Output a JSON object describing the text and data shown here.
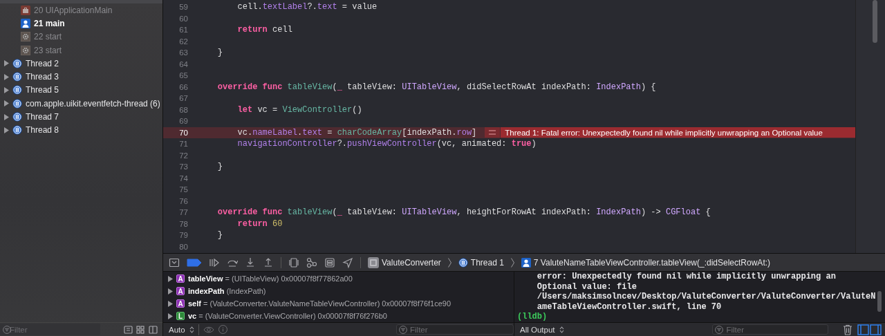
{
  "sidebar": {
    "frames": [
      {
        "label": "20 UIApplicationMain",
        "kind": "library"
      },
      {
        "label": "21 main",
        "kind": "user"
      },
      {
        "label": "22 start",
        "kind": "system"
      },
      {
        "label": "23 start",
        "kind": "system"
      }
    ],
    "threads": [
      {
        "label": "Thread 2",
        "expanded": false
      },
      {
        "label": "Thread 3",
        "expanded": false
      },
      {
        "label": "Thread 5",
        "expanded": false
      },
      {
        "label": "com.apple.uikit.eventfetch-thread (6)",
        "expanded": false
      },
      {
        "label": "Thread 7",
        "expanded": false
      },
      {
        "label": "Thread 8",
        "expanded": false
      }
    ],
    "filter": {
      "placeholder": "Filter"
    }
  },
  "editor": {
    "lines": [
      {
        "number": "59",
        "tokens": [
          {
            "text": "        cell.",
            "kind": "plain"
          },
          {
            "text": "textLabel",
            "kind": "prop"
          },
          {
            "text": "?.",
            "kind": "plain"
          },
          {
            "text": "text",
            "kind": "prop"
          },
          {
            "text": " = value",
            "kind": "plain"
          }
        ]
      },
      {
        "number": "60"
      },
      {
        "number": "61",
        "tokens": [
          {
            "text": "        return",
            "kind": "kw"
          },
          {
            "text": " cell",
            "kind": "plain"
          }
        ]
      },
      {
        "number": "62"
      },
      {
        "number": "63",
        "tokens": [
          {
            "text": "    }",
            "kind": "plain"
          }
        ]
      },
      {
        "number": "64"
      },
      {
        "number": "65"
      },
      {
        "number": "66",
        "tokens": [
          {
            "text": "    override func",
            "kind": "kw"
          },
          {
            "text": " tableView",
            "kind": "fn"
          },
          {
            "text": "(",
            "kind": "plain"
          },
          {
            "text": "_",
            "kind": "kw"
          },
          {
            "text": " tableView: ",
            "kind": "plain"
          },
          {
            "text": "UITableView",
            "kind": "type"
          },
          {
            "text": ", didSelectRowAt indexPath: ",
            "kind": "plain"
          },
          {
            "text": "IndexPath",
            "kind": "type"
          },
          {
            "text": ") {",
            "kind": "plain"
          }
        ]
      },
      {
        "number": "67"
      },
      {
        "number": "68",
        "tokens": [
          {
            "text": "        let",
            "kind": "kw"
          },
          {
            "text": " vc = ",
            "kind": "plain"
          },
          {
            "text": "ViewController",
            "kind": "fn"
          },
          {
            "text": "()",
            "kind": "plain"
          }
        ]
      },
      {
        "number": "69"
      },
      {
        "number": "70",
        "tokens": [
          {
            "text": "        vc.",
            "kind": "plain"
          },
          {
            "text": "nameLabel",
            "kind": "prop"
          },
          {
            "text": ".",
            "kind": "plain"
          },
          {
            "text": "text",
            "kind": "prop"
          },
          {
            "text": " = ",
            "kind": "plain"
          },
          {
            "text": "charCodeArray",
            "kind": "fn"
          },
          {
            "text": "[indexPath.",
            "kind": "plain"
          },
          {
            "text": "row",
            "kind": "prop"
          },
          {
            "text": "]",
            "kind": "plain"
          }
        ],
        "error": "Thread 1: Fatal error: Unexpectedly found nil while implicitly unwrapping an Optional value"
      },
      {
        "number": "71",
        "tokens": [
          {
            "text": "        navigationController",
            "kind": "prop"
          },
          {
            "text": "?.",
            "kind": "plain"
          },
          {
            "text": "pushViewController",
            "kind": "prop"
          },
          {
            "text": "(vc, animated: ",
            "kind": "plain"
          },
          {
            "text": "true",
            "kind": "kw"
          },
          {
            "text": ")",
            "kind": "plain"
          }
        ]
      },
      {
        "number": "72"
      },
      {
        "number": "73",
        "tokens": [
          {
            "text": "    }",
            "kind": "plain"
          }
        ]
      },
      {
        "number": "74"
      },
      {
        "number": "75"
      },
      {
        "number": "76"
      },
      {
        "number": "77",
        "tokens": [
          {
            "text": "    override func",
            "kind": "kw"
          },
          {
            "text": " tableView",
            "kind": "fn"
          },
          {
            "text": "(",
            "kind": "plain"
          },
          {
            "text": "_",
            "kind": "kw"
          },
          {
            "text": " tableView: ",
            "kind": "plain"
          },
          {
            "text": "UITableView",
            "kind": "type"
          },
          {
            "text": ", heightForRowAt indexPath: ",
            "kind": "plain"
          },
          {
            "text": "IndexPath",
            "kind": "type"
          },
          {
            "text": ") -> ",
            "kind": "plain"
          },
          {
            "text": "CGFloat",
            "kind": "type"
          },
          {
            "text": " {",
            "kind": "plain"
          }
        ]
      },
      {
        "number": "78",
        "tokens": [
          {
            "text": "        return",
            "kind": "kw"
          },
          {
            "text": " 60",
            "kind": "num"
          }
        ]
      },
      {
        "number": "79",
        "tokens": [
          {
            "text": "    }",
            "kind": "plain"
          }
        ]
      },
      {
        "number": "80"
      }
    ]
  },
  "debug_bar": {
    "breakpoints_active": true,
    "breadcrumb": [
      {
        "label": "ValuteConverter",
        "kind": "app"
      },
      {
        "label": "Thread 1",
        "kind": "thread"
      },
      {
        "label": "7 ValuteNameTableViewController.tableView(_:didSelectRowAt:)",
        "kind": "frame"
      }
    ]
  },
  "variables": {
    "items": [
      {
        "badge": "A",
        "kind": "argument",
        "name": "tableView",
        "detail": "= (UITableView) 0x00007f8f77862a00"
      },
      {
        "badge": "A",
        "kind": "argument",
        "name": "indexPath",
        "detail": "(IndexPath)"
      },
      {
        "badge": "A",
        "kind": "argument",
        "name": "self",
        "detail": "= (ValuteConverter.ValuteNameTableViewController) 0x00007f8f76f1ce90"
      },
      {
        "badge": "L",
        "kind": "local",
        "name": "vc",
        "detail": "= (ValuteConverter.ViewController) 0x00007f8f76f276b0"
      }
    ],
    "scope": "Auto",
    "filter": {
      "placeholder": "Filter"
    }
  },
  "console": {
    "lines": [
      {
        "text": "    error: Unexpectedly found nil while implicitly unwrapping an",
        "kind": "output"
      },
      {
        "text": "    Optional value: file",
        "kind": "output"
      },
      {
        "text": "    /Users/maksimsolncev/Desktop/ValuteConverter/ValuteConverter/ValuteN",
        "kind": "output"
      },
      {
        "text": "    ameTableViewController.swift, line 70",
        "kind": "output"
      },
      {
        "text": "(lldb)",
        "kind": "prompt"
      }
    ],
    "output_mode": "All Output",
    "filter": {
      "placeholder": "Filter"
    }
  }
}
